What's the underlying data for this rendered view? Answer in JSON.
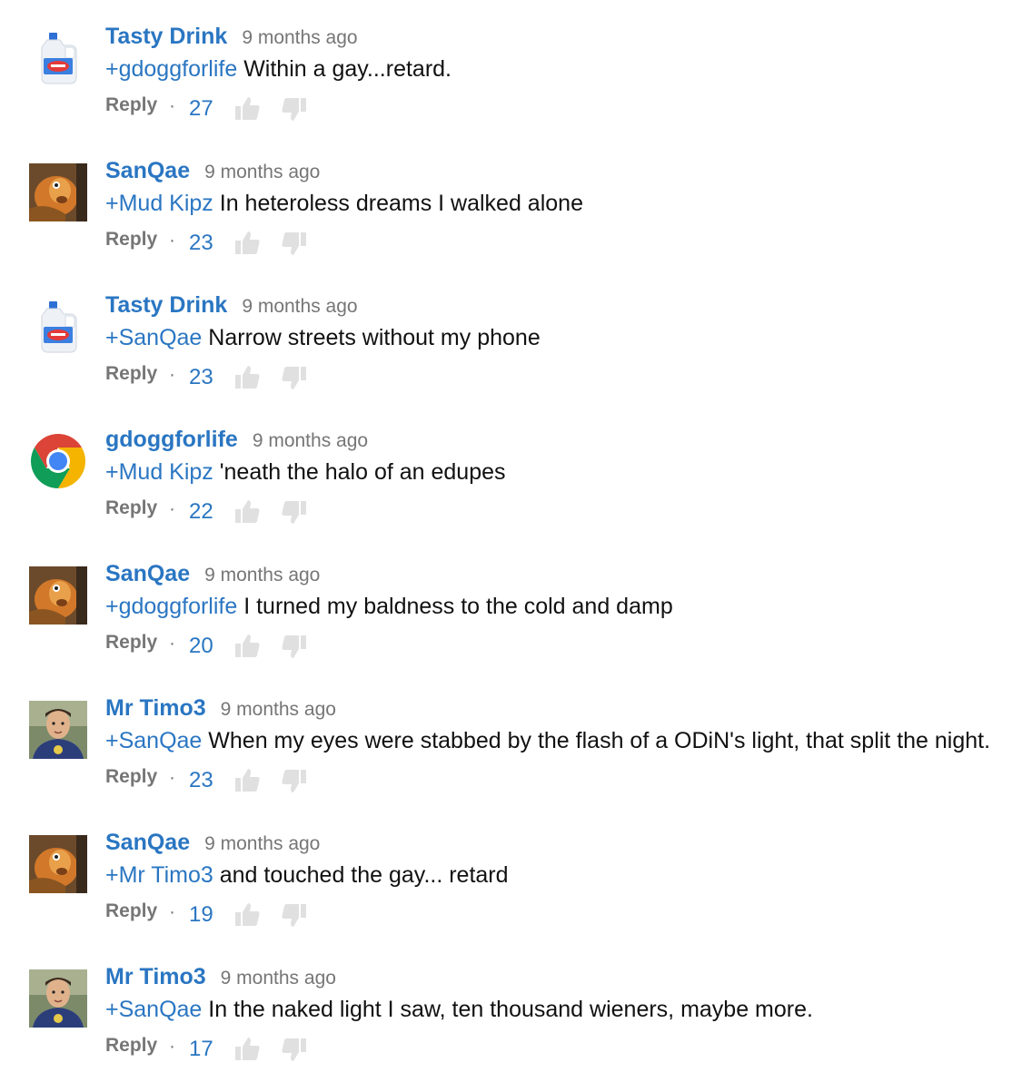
{
  "reply_label": "Reply",
  "separator": "·",
  "colors": {
    "link": "#2a76c2",
    "meta": "#767676",
    "text": "#111111"
  },
  "comments": [
    {
      "author": "Tasty Drink",
      "time": "9 months ago",
      "mention": "+gdoggforlife",
      "text": " Within a gay...retard.",
      "likes": "27",
      "avatar": "bleach-bottle-avatar"
    },
    {
      "author": "SanQae",
      "time": "9 months ago",
      "mention": "+Mud Kipz",
      "text": " In heteroless dreams I walked alone",
      "likes": "23",
      "avatar": "orange-creature-avatar"
    },
    {
      "author": "Tasty Drink",
      "time": "9 months ago",
      "mention": "+SanQae",
      "text": " Narrow streets without my phone",
      "likes": "23",
      "avatar": "bleach-bottle-avatar"
    },
    {
      "author": "gdoggforlife",
      "time": "9 months ago",
      "mention": "+Mud Kipz",
      "text": " 'neath the halo of an edupes",
      "likes": "22",
      "avatar": "chrome-logo-avatar"
    },
    {
      "author": "SanQae",
      "time": "9 months ago",
      "mention": "+gdoggforlife",
      "text": " I turned my baldness to the cold and damp",
      "likes": "20",
      "avatar": "orange-creature-avatar"
    },
    {
      "author": "Mr Timo3",
      "time": "9 months ago",
      "mention": "+SanQae",
      "text": " When my eyes were stabbed by the flash of a ODiN's light, that split the night.",
      "likes": "23",
      "avatar": "man-portrait-avatar"
    },
    {
      "author": "SanQae",
      "time": "9 months ago",
      "mention": "+Mr Timo3",
      "text": " and touched the gay... retard",
      "likes": "19",
      "avatar": "orange-creature-avatar"
    },
    {
      "author": "Mr Timo3",
      "time": "9 months ago",
      "mention": "+SanQae",
      "text": " In the naked light I saw, ten thousand wieners, maybe more.",
      "likes": "17",
      "avatar": "man-portrait-avatar"
    }
  ]
}
